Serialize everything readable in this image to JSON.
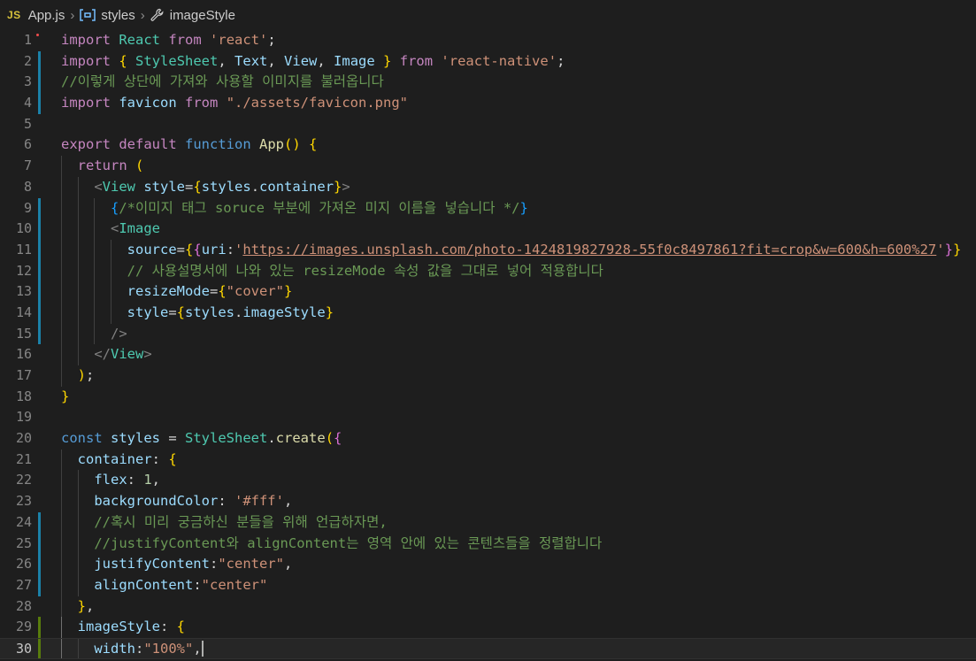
{
  "breadcrumb": {
    "file_badge": "JS",
    "file": "App.js",
    "item1": "styles",
    "item2": "imageStyle"
  },
  "lines": [
    {
      "n": "1",
      "t": "import React from 'react';"
    },
    {
      "n": "2",
      "t": "import { StyleSheet, Text, View, Image } from 'react-native';"
    },
    {
      "n": "3",
      "t": "//이렇게 상단에 가져와 사용할 이미지를 불러옵니다"
    },
    {
      "n": "4",
      "t": "import favicon from \"./assets/favicon.png\""
    },
    {
      "n": "5",
      "t": ""
    },
    {
      "n": "6",
      "t": "export default function App() {"
    },
    {
      "n": "7",
      "t": "  return ("
    },
    {
      "n": "8",
      "t": "    <View style={styles.container}>"
    },
    {
      "n": "9",
      "t": "      {/*이미지 태그 soruce 부분에 가져온 미지 이름을 넣습니다 */}"
    },
    {
      "n": "10",
      "t": "      <Image"
    },
    {
      "n": "11",
      "t": "        source={{uri:'https://images.unsplash.com/photo-1424819827928-55f0c8497861?fit=crop&w=600&h=600%27'}}"
    },
    {
      "n": "12",
      "t": "        // 사용설명서에 나와 있는 resizeMode 속성 값을 그대로 넣어 적용합니다"
    },
    {
      "n": "13",
      "t": "        resizeMode={\"cover\"}"
    },
    {
      "n": "14",
      "t": "        style={styles.imageStyle}"
    },
    {
      "n": "15",
      "t": "      />"
    },
    {
      "n": "16",
      "t": "    </View>"
    },
    {
      "n": "17",
      "t": "  );"
    },
    {
      "n": "18",
      "t": "}"
    },
    {
      "n": "19",
      "t": ""
    },
    {
      "n": "20",
      "t": "const styles = StyleSheet.create({"
    },
    {
      "n": "21",
      "t": "  container: {"
    },
    {
      "n": "22",
      "t": "    flex: 1,"
    },
    {
      "n": "23",
      "t": "    backgroundColor: '#fff',"
    },
    {
      "n": "24",
      "t": "    //혹시 미리 궁금하신 분들을 위해 언급하자면,"
    },
    {
      "n": "25",
      "t": "    //justifyContent와 alignContent는 영역 안에 있는 콘텐츠들을 정렬합니다"
    },
    {
      "n": "26",
      "t": "    justifyContent:\"center\","
    },
    {
      "n": "27",
      "t": "    alignContent:\"center\""
    },
    {
      "n": "28",
      "t": "  },"
    },
    {
      "n": "29",
      "t": "  imageStyle: {"
    },
    {
      "n": "30",
      "t": "    width:\"100%\","
    }
  ],
  "colors": {
    "background": "#1e1e1e",
    "modified_bar": "#1b81a8",
    "added_bar": "#587c0c"
  }
}
